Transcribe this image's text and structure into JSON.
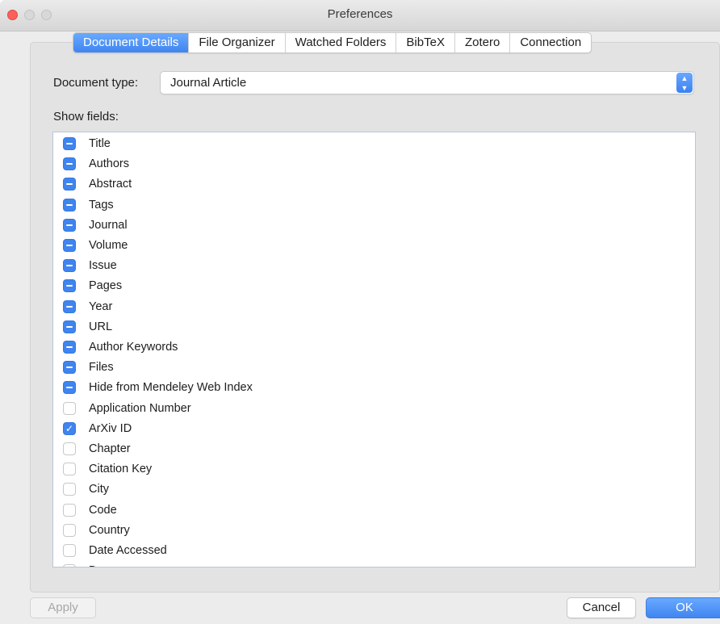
{
  "window": {
    "title": "Preferences"
  },
  "tabs": [
    {
      "label": "Document Details",
      "active": true
    },
    {
      "label": "File Organizer",
      "active": false
    },
    {
      "label": "Watched Folders",
      "active": false
    },
    {
      "label": "BibTeX",
      "active": false
    },
    {
      "label": "Zotero",
      "active": false
    },
    {
      "label": "Connection",
      "active": false
    }
  ],
  "document_type": {
    "label": "Document type:",
    "value": "Journal Article"
  },
  "show_fields": {
    "label": "Show fields:",
    "items": [
      {
        "label": "Title",
        "state": "mixed"
      },
      {
        "label": "Authors",
        "state": "mixed"
      },
      {
        "label": "Abstract",
        "state": "mixed"
      },
      {
        "label": "Tags",
        "state": "mixed"
      },
      {
        "label": "Journal",
        "state": "mixed"
      },
      {
        "label": "Volume",
        "state": "mixed"
      },
      {
        "label": "Issue",
        "state": "mixed"
      },
      {
        "label": "Pages",
        "state": "mixed"
      },
      {
        "label": "Year",
        "state": "mixed"
      },
      {
        "label": "URL",
        "state": "mixed"
      },
      {
        "label": "Author Keywords",
        "state": "mixed"
      },
      {
        "label": "Files",
        "state": "mixed"
      },
      {
        "label": "Hide from Mendeley Web Index",
        "state": "mixed"
      },
      {
        "label": "Application Number",
        "state": "off"
      },
      {
        "label": "ArXiv ID",
        "state": "on"
      },
      {
        "label": "Chapter",
        "state": "off"
      },
      {
        "label": "Citation Key",
        "state": "off"
      },
      {
        "label": "City",
        "state": "off"
      },
      {
        "label": "Code",
        "state": "off"
      },
      {
        "label": "Country",
        "state": "off"
      },
      {
        "label": "Date Accessed",
        "state": "off"
      },
      {
        "label": "D...",
        "state": "off"
      }
    ]
  },
  "buttons": {
    "apply": "Apply",
    "cancel": "Cancel",
    "ok": "OK"
  },
  "colors": {
    "accent": "#3f84ef",
    "close_light": "#fc605b"
  }
}
